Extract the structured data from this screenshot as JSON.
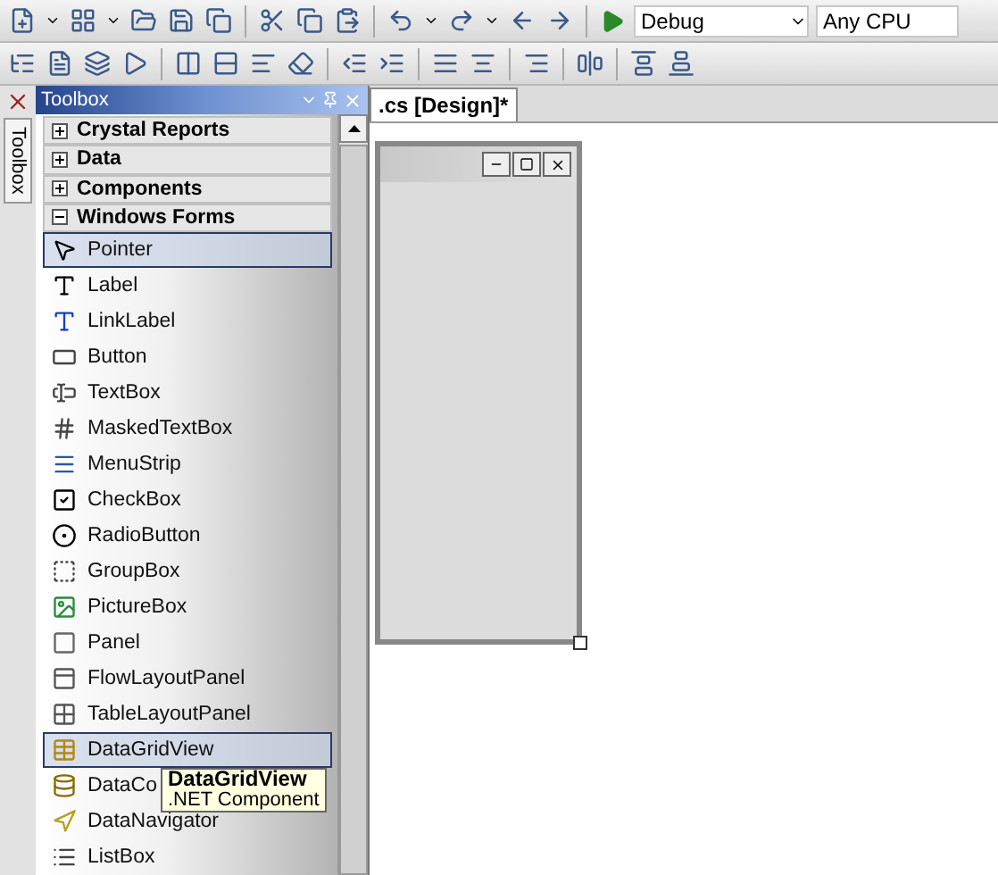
{
  "toolbar": {
    "configuration": "Debug",
    "platform": "Any CPU"
  },
  "side_tab": {
    "label": "Toolbox"
  },
  "toolbox": {
    "title": "Toolbox",
    "categories": [
      {
        "label": "Crystal Reports",
        "expanded": false
      },
      {
        "label": "Data",
        "expanded": false
      },
      {
        "label": "Components",
        "expanded": false
      },
      {
        "label": "Windows Forms",
        "expanded": true,
        "items": [
          {
            "label": "Pointer",
            "highlighted": true
          },
          {
            "label": "Label",
            "highlighted": false
          },
          {
            "label": "LinkLabel",
            "highlighted": false
          },
          {
            "label": "Button",
            "highlighted": false
          },
          {
            "label": "TextBox",
            "highlighted": false
          },
          {
            "label": "MaskedTextBox",
            "highlighted": false
          },
          {
            "label": "MenuStrip",
            "highlighted": false
          },
          {
            "label": "CheckBox",
            "highlighted": false
          },
          {
            "label": "RadioButton",
            "highlighted": false
          },
          {
            "label": "GroupBox",
            "highlighted": false
          },
          {
            "label": "PictureBox",
            "highlighted": false
          },
          {
            "label": "Panel",
            "highlighted": false
          },
          {
            "label": "FlowLayoutPanel",
            "highlighted": false
          },
          {
            "label": "TableLayoutPanel",
            "highlighted": false
          },
          {
            "label": "DataGridView",
            "highlighted": true
          },
          {
            "label": "DataCo",
            "highlighted": false
          },
          {
            "label": "DataNavigator",
            "highlighted": false
          },
          {
            "label": "ListBox",
            "highlighted": false
          }
        ]
      }
    ]
  },
  "tooltip": {
    "title": "DataGridView",
    "subtitle": ".NET Component"
  },
  "document_tab": {
    "label": ".cs [Design]*",
    "selected": true
  }
}
